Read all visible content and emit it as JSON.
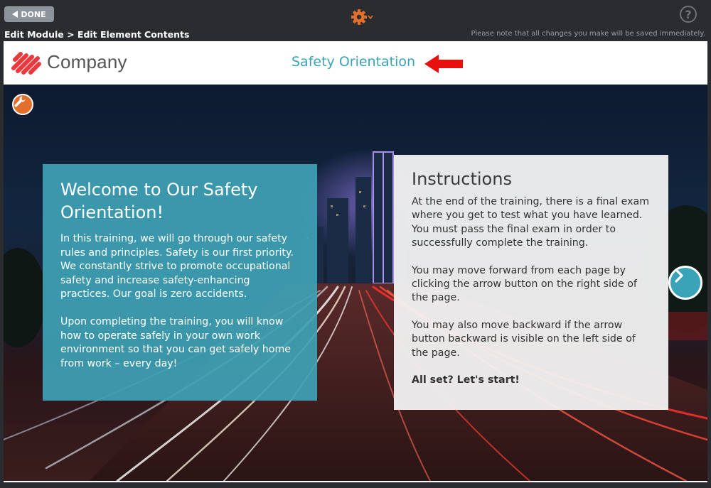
{
  "toolbar": {
    "done_label": "DONE",
    "breadcrumb": "Edit Module > Edit Element Contents",
    "notice": "Please note that all changes you make will be saved immediately.",
    "help_label": "?",
    "accent": "#e36f2d"
  },
  "module": {
    "company": "Company",
    "title": "Safety Orientation",
    "title_color": "#3aa3b8"
  },
  "welcome": {
    "heading": "Welcome to Our Safety Orientation!",
    "p1": "In this training, we will go through our safety rules and principles. Safety is our first priority. We constantly strive to promote occupational safety and increase safety-enhancing practices. Our goal is zero accidents.",
    "p2": "Upon completing the training, you will know how to operate safely in your own work environment so that you can get safely home from work – every day!"
  },
  "instructions": {
    "heading": "Instructions",
    "p1": "At the end of the training, there is a final exam where you get to test what you have learned.  You must pass the final exam in order to successfully complete the training.",
    "p2": "You may move forward from each page by clicking the arrow button on the right side of the page.",
    "p3": "You may also move backward if the arrow button backward is visible on the left side of the page.",
    "p4": "All set? Let's start!"
  },
  "icons": [
    "back-triangle-icon",
    "gear-icon",
    "help-icon",
    "company-logo",
    "red-arrow-icon",
    "wrench-icon",
    "chevron-right-icon"
  ]
}
